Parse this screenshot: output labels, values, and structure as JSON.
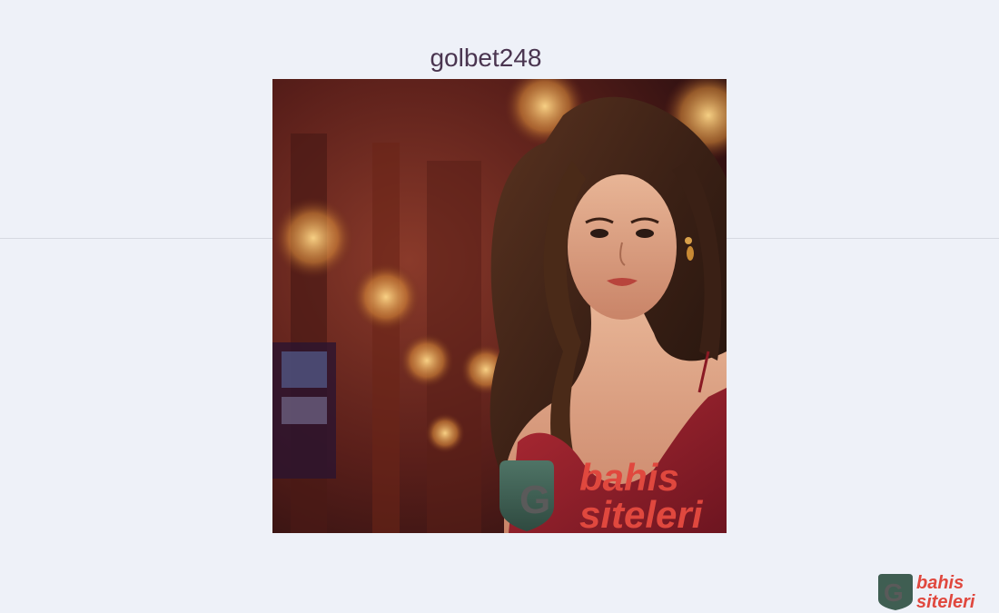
{
  "page": {
    "title": "golbet248"
  },
  "hero": {
    "image_alt": "Woman in red dress in casino setting",
    "watermark": {
      "line1": "bahis",
      "line2": "siteleri",
      "badge_letter": "G"
    }
  },
  "corner_logo": {
    "line1": "bahis",
    "line2": "siteleri",
    "badge_letter": "G"
  },
  "colors": {
    "background": "#eef1f8",
    "brand_red": "#e0483e",
    "badge_green": "#3f5e52",
    "title": "#4a3550"
  }
}
